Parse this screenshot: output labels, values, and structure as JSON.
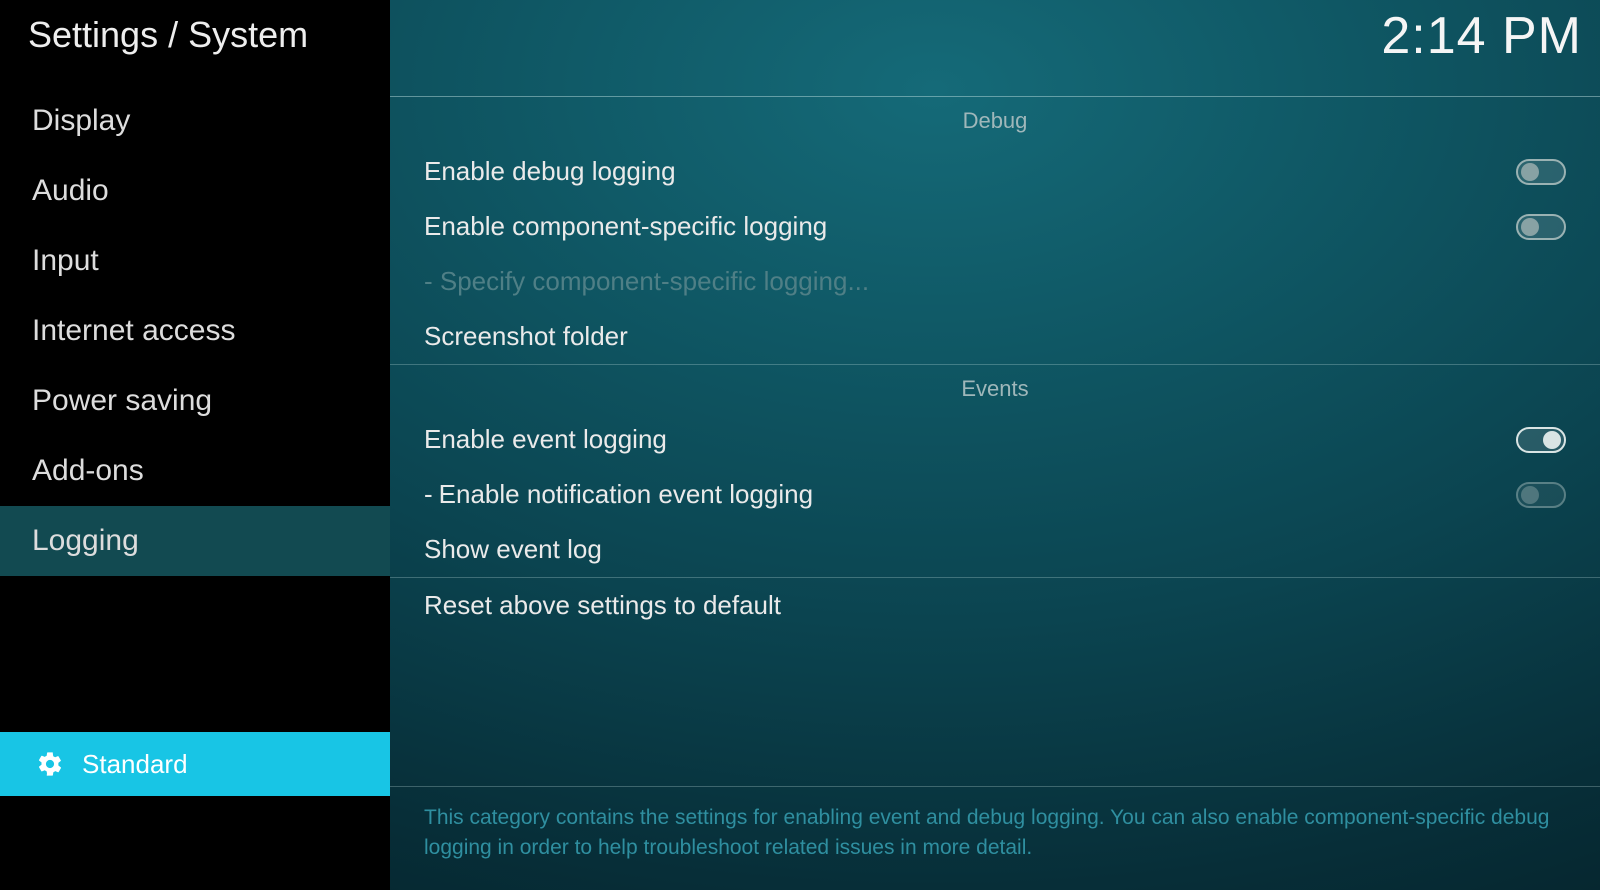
{
  "header": {
    "breadcrumb": "Settings / System",
    "clock": "2:14 PM"
  },
  "sidebar": {
    "items": [
      {
        "label": "Display"
      },
      {
        "label": "Audio"
      },
      {
        "label": "Input"
      },
      {
        "label": "Internet access"
      },
      {
        "label": "Power saving"
      },
      {
        "label": "Add-ons"
      },
      {
        "label": "Logging"
      }
    ],
    "level": {
      "label": "Standard"
    }
  },
  "main": {
    "sections": {
      "debug": {
        "title": "Debug",
        "enable_debug_logging": "Enable debug logging",
        "enable_component_logging": "Enable component-specific logging",
        "specify_component_logging": "- Specify component-specific logging...",
        "screenshot_folder": "Screenshot folder"
      },
      "events": {
        "title": "Events",
        "enable_event_logging": "Enable event logging",
        "enable_notification_event_logging_prefix": "-",
        "enable_notification_event_logging": "Enable notification event logging",
        "show_event_log": "Show event log"
      }
    },
    "reset": "Reset above settings to default",
    "help": "This category contains the settings for enabling event and debug logging. You can also enable component-specific debug logging in order to help troubleshoot related issues in more detail."
  },
  "toggles": {
    "enable_debug_logging": false,
    "enable_component_logging": false,
    "enable_event_logging": true,
    "enable_notification_event_logging": false
  }
}
